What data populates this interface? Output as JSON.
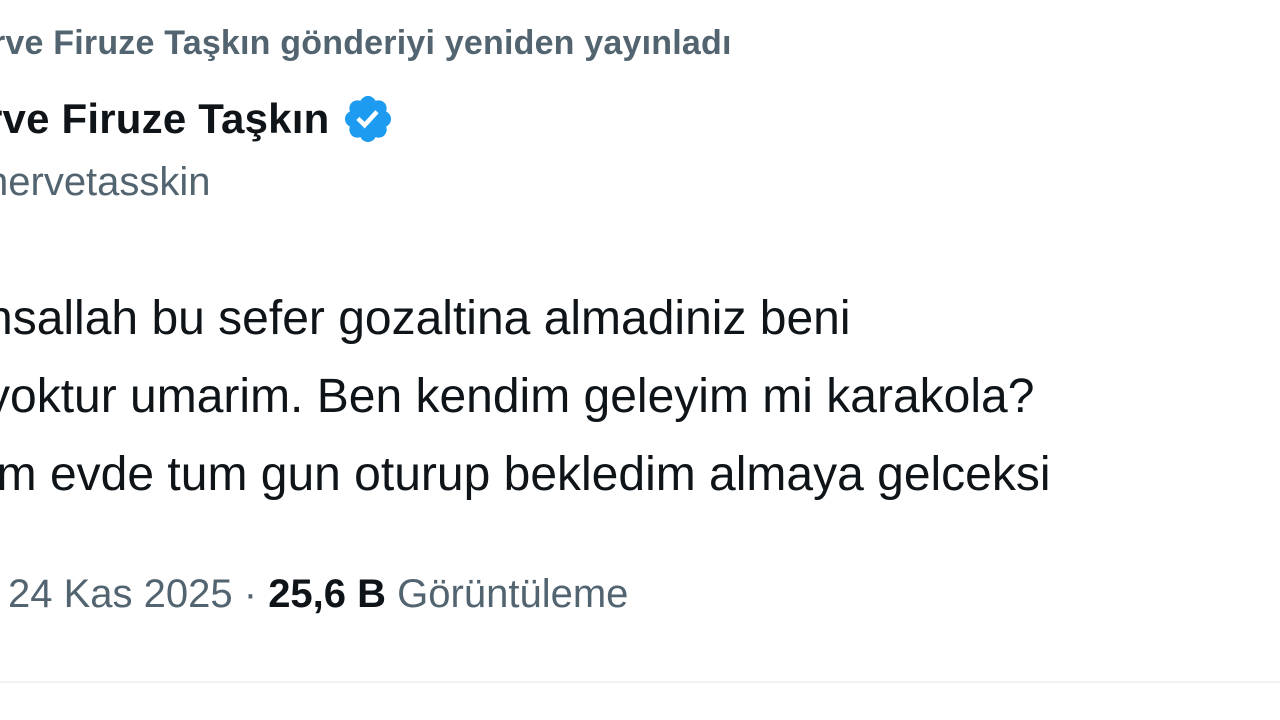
{
  "repost": {
    "text": "rve Firuze Taşkın gönderiyi yeniden yayınladı"
  },
  "author": {
    "display_name": "rve Firuze Taşkın",
    "handle": "hervetasskin",
    "verified_icon": "verified-badge-icon",
    "verified_color": "#1d9bf0"
  },
  "tweet": {
    "lines": [
      "nsallah bu sefer gozaltina almadiniz beni",
      " yoktur umarim. Ben kendim geleyim mi karakola?",
      "im evde tum gun oturup bekledim almaya gelceksi"
    ]
  },
  "meta": {
    "date": "24 Kas 2025",
    "separator": " · ",
    "views_count": "25,6 B",
    "views_label": " Görüntüleme"
  },
  "colors": {
    "text_primary": "#0f1419",
    "text_secondary": "#536471",
    "divider": "#eff3f4"
  }
}
